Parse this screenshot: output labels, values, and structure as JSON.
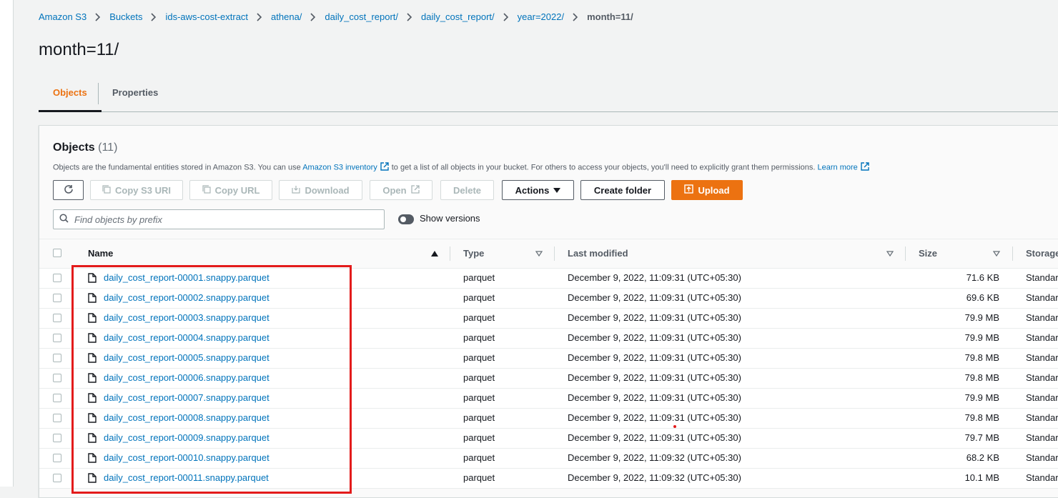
{
  "breadcrumb": [
    "Amazon S3",
    "Buckets",
    "ids-aws-cost-extract",
    "athena/",
    "daily_cost_report/",
    "daily_cost_report/",
    "year=2022/",
    "month=11/"
  ],
  "page_title": "month=11/",
  "tabs": [
    {
      "label": "Objects",
      "active": true
    },
    {
      "label": "Properties",
      "active": false
    }
  ],
  "objects_panel": {
    "title": "Objects",
    "count": "(11)",
    "desc_prefix": "Objects are the fundamental entities stored in Amazon S3. You can use",
    "inventory_link": "Amazon S3 inventory",
    "desc_middle": "to get a list of all objects in your bucket. For others to access your objects, you'll need to explicitly grant them permissions.",
    "learn_more": "Learn more"
  },
  "toolbar": {
    "refresh_icon": "refresh-icon",
    "copy_s3_uri": "Copy S3 URI",
    "copy_url": "Copy URL",
    "download": "Download",
    "open": "Open",
    "delete": "Delete",
    "actions": "Actions",
    "create_folder": "Create folder",
    "upload": "Upload"
  },
  "search": {
    "placeholder": "Find objects by prefix",
    "value": ""
  },
  "show_versions": {
    "label": "Show versions",
    "on": false
  },
  "columns": [
    "Name",
    "Type",
    "Last modified",
    "Size",
    "Storage"
  ],
  "rows": [
    {
      "name": "daily_cost_report-00001.snappy.parquet",
      "type": "parquet",
      "modified": "December 9, 2022, 11:09:31 (UTC+05:30)",
      "size": "71.6 KB",
      "storage": "Standard"
    },
    {
      "name": "daily_cost_report-00002.snappy.parquet",
      "type": "parquet",
      "modified": "December 9, 2022, 11:09:31 (UTC+05:30)",
      "size": "69.6 KB",
      "storage": "Standard"
    },
    {
      "name": "daily_cost_report-00003.snappy.parquet",
      "type": "parquet",
      "modified": "December 9, 2022, 11:09:31 (UTC+05:30)",
      "size": "79.9 MB",
      "storage": "Standard"
    },
    {
      "name": "daily_cost_report-00004.snappy.parquet",
      "type": "parquet",
      "modified": "December 9, 2022, 11:09:31 (UTC+05:30)",
      "size": "79.9 MB",
      "storage": "Standard"
    },
    {
      "name": "daily_cost_report-00005.snappy.parquet",
      "type": "parquet",
      "modified": "December 9, 2022, 11:09:31 (UTC+05:30)",
      "size": "79.8 MB",
      "storage": "Standard"
    },
    {
      "name": "daily_cost_report-00006.snappy.parquet",
      "type": "parquet",
      "modified": "December 9, 2022, 11:09:31 (UTC+05:30)",
      "size": "79.8 MB",
      "storage": "Standard"
    },
    {
      "name": "daily_cost_report-00007.snappy.parquet",
      "type": "parquet",
      "modified": "December 9, 2022, 11:09:31 (UTC+05:30)",
      "size": "79.9 MB",
      "storage": "Standard"
    },
    {
      "name": "daily_cost_report-00008.snappy.parquet",
      "type": "parquet",
      "modified": "December 9, 2022, 11:09:31 (UTC+05:30)",
      "size": "79.8 MB",
      "storage": "Standard"
    },
    {
      "name": "daily_cost_report-00009.snappy.parquet",
      "type": "parquet",
      "modified": "December 9, 2022, 11:09:31 (UTC+05:30)",
      "size": "79.7 MB",
      "storage": "Standard"
    },
    {
      "name": "daily_cost_report-00010.snappy.parquet",
      "type": "parquet",
      "modified": "December 9, 2022, 11:09:32 (UTC+05:30)",
      "size": "68.2 KB",
      "storage": "Standard"
    },
    {
      "name": "daily_cost_report-00011.snappy.parquet",
      "type": "parquet",
      "modified": "December 9, 2022, 11:09:32 (UTC+05:30)",
      "size": "10.1 MB",
      "storage": "Standard"
    }
  ],
  "colors": {
    "accent": "#ec7211",
    "link": "#0073bb",
    "highlight": "#e31b1b"
  }
}
